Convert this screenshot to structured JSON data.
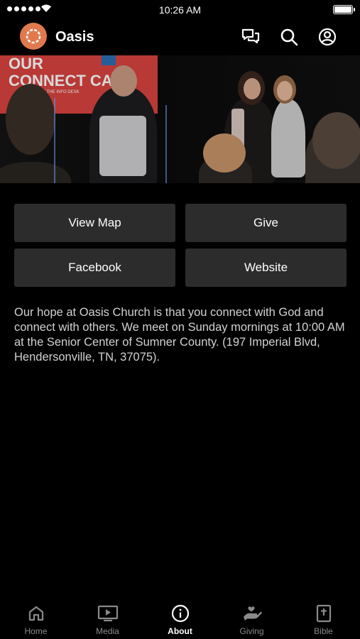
{
  "status_bar": {
    "time": "10:26 AM"
  },
  "header": {
    "title": "Oasis",
    "icons": [
      "chat-icon",
      "search-icon",
      "account-icon"
    ]
  },
  "hero": {
    "screen_line1": "OUR",
    "screen_line2": "CONNECT CA",
    "screen_fine_print": "E IN AT THE INFO DESK"
  },
  "buttons": {
    "view_map": "View Map",
    "give": "Give",
    "facebook": "Facebook",
    "website": "Website"
  },
  "description": "Our hope at Oasis Church is that you connect with God and connect with others. We meet on Sunday mornings at 10:00 AM at the Senior Center of Sumner County. (197 Imperial Blvd, Hendersonville, TN, 37075).",
  "tabs": [
    {
      "label": "Home",
      "icon": "home-icon"
    },
    {
      "label": "Media",
      "icon": "tv-play-icon"
    },
    {
      "label": "About",
      "icon": "info-icon",
      "active": true
    },
    {
      "label": "Giving",
      "icon": "giving-hand-icon"
    },
    {
      "label": "Bible",
      "icon": "bible-icon"
    }
  ],
  "colors": {
    "background": "#000000",
    "button": "#2c2c2c",
    "brand": "#e07a4e",
    "inactive_tab": "#8a8a8a"
  }
}
